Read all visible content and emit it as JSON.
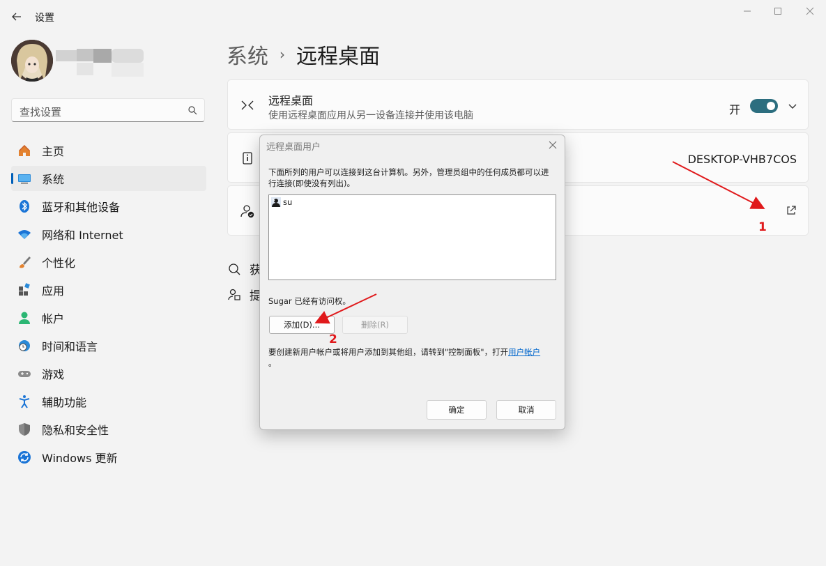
{
  "window": {
    "title": "设置",
    "controls": [
      "minimize",
      "maximize",
      "close"
    ]
  },
  "sidebar": {
    "search_placeholder": "查找设置",
    "items": [
      {
        "label": "主页",
        "icon": "home-icon",
        "active": false
      },
      {
        "label": "系统",
        "icon": "system-icon",
        "active": true
      },
      {
        "label": "蓝牙和其他设备",
        "icon": "bluetooth-icon",
        "active": false
      },
      {
        "label": "网络和 Internet",
        "icon": "wifi-icon",
        "active": false
      },
      {
        "label": "个性化",
        "icon": "brush-icon",
        "active": false
      },
      {
        "label": "应用",
        "icon": "apps-icon",
        "active": false
      },
      {
        "label": "帐户",
        "icon": "account-icon",
        "active": false
      },
      {
        "label": "时间和语言",
        "icon": "globe-clock-icon",
        "active": false
      },
      {
        "label": "游戏",
        "icon": "gamepad-icon",
        "active": false
      },
      {
        "label": "辅助功能",
        "icon": "accessibility-icon",
        "active": false
      },
      {
        "label": "隐私和安全性",
        "icon": "shield-icon",
        "active": false
      },
      {
        "label": "Windows 更新",
        "icon": "update-icon",
        "active": false
      }
    ]
  },
  "main": {
    "breadcrumb": {
      "parent": "系统",
      "separator": "›",
      "current": "远程桌面"
    },
    "remote_card": {
      "title": "远程桌面",
      "description": "使用远程桌面应用从另一设备连接并使用该电脑",
      "toggle_label": "开",
      "toggle_on": true
    },
    "pc_name_card": {
      "value": "DESKTOP-VHB7COS"
    },
    "related": [
      "获",
      "提"
    ]
  },
  "dialog": {
    "title": "远程桌面用户",
    "description": "下面所列的用户可以连接到这台计算机。另外，管理员组中的任何成员都可以进行连接(即使没有列出)。",
    "users": [
      "su"
    ],
    "access_text": "Sugar 已经有访问权。",
    "add_button": "添加(D)...",
    "remove_button": "删除(R)",
    "info_text": "要创建新用户帐户或将用户添加到其他组，请转到\"控制面板\"，打开",
    "info_link": "用户帐户",
    "info_end": "。",
    "ok_button": "确定",
    "cancel_button": "取消"
  },
  "annotations": {
    "first": "1",
    "second": "2",
    "color": "#e0191b"
  },
  "colors": {
    "accent": "#005fb8",
    "toggle": "#2c6e7f",
    "background": "#f3f3f3"
  }
}
